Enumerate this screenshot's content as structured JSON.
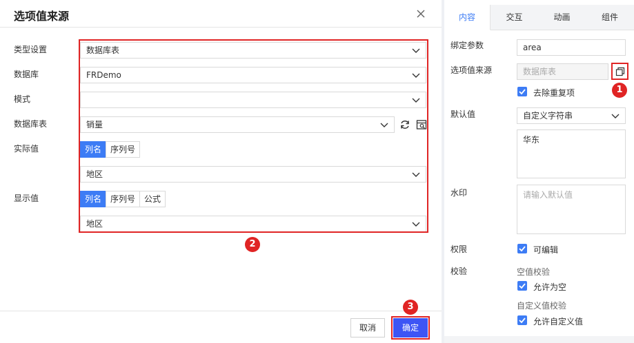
{
  "dialog": {
    "title": "选项值来源",
    "labels": {
      "type": "类型设置",
      "database": "数据库",
      "schema": "模式",
      "table": "数据库表",
      "actual": "实际值",
      "display": "显示值"
    },
    "values": {
      "type": "数据库表",
      "database": "FRDemo",
      "schema": "",
      "table": "销量",
      "actual_field": "地区",
      "display_field": "地区"
    },
    "actual_tabs": [
      "列名",
      "序列号"
    ],
    "display_tabs": [
      "列名",
      "序列号",
      "公式"
    ],
    "buttons": {
      "cancel": "取消",
      "confirm": "确定"
    }
  },
  "badges": {
    "one": "1",
    "two": "2",
    "three": "3"
  },
  "panel": {
    "tabs": [
      "内容",
      "交互",
      "动画",
      "组件"
    ],
    "active_tab": "内容",
    "bind_param": {
      "label": "绑定参数",
      "value": "area"
    },
    "option_source": {
      "label": "选项值来源",
      "value": "数据库表"
    },
    "dedupe": {
      "label": "去除重复项",
      "checked": true
    },
    "default_value": {
      "label": "默认值",
      "select": "自定义字符串",
      "text": "华东"
    },
    "watermark": {
      "label": "水印",
      "placeholder": "请输入默认值"
    },
    "permission": {
      "label": "权限",
      "checkbox": "可编辑"
    },
    "validation": {
      "label": "校验",
      "empty_title": "空值校验",
      "allow_empty": "允许为空",
      "custom_title": "自定义值校验",
      "allow_custom": "允许自定义值"
    }
  },
  "colors": {
    "accent": "#3d7cf5",
    "confirm": "#3d55f5",
    "highlight": "#e02424"
  }
}
